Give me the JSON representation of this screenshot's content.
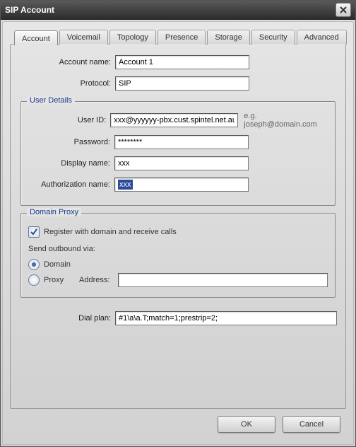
{
  "window": {
    "title": "SIP Account"
  },
  "tabs": [
    {
      "label": "Account",
      "selected": true
    },
    {
      "label": "Voicemail"
    },
    {
      "label": "Topology"
    },
    {
      "label": "Presence"
    },
    {
      "label": "Storage"
    },
    {
      "label": "Security"
    },
    {
      "label": "Advanced"
    }
  ],
  "form": {
    "account_name_label": "Account name:",
    "account_name_value": "Account 1",
    "protocol_label": "Protocol:",
    "protocol_value": "SIP"
  },
  "user_details": {
    "legend": "User Details",
    "user_id_label": "User ID:",
    "user_id_value": "xxx@yyyyyy-pbx.cust.spintel.net.au",
    "user_id_hint": "e.g. joseph@domain.com",
    "password_label": "Password:",
    "password_value": "********",
    "display_name_label": "Display name:",
    "display_name_value": "xxx",
    "auth_name_label": "Authorization name:",
    "auth_name_value": "xxx"
  },
  "domain_proxy": {
    "legend": "Domain Proxy",
    "register_label": "Register with domain and receive calls",
    "register_checked": true,
    "send_outbound_label": "Send outbound via:",
    "radio_domain_label": "Domain",
    "radio_domain_checked": true,
    "radio_proxy_label": "Proxy",
    "radio_proxy_checked": false,
    "address_label": "Address:",
    "address_value": ""
  },
  "dial_plan": {
    "label": "Dial plan:",
    "value": "#1\\a\\a.T;match=1;prestrip=2;"
  },
  "footer": {
    "ok_label": "OK",
    "cancel_label": "Cancel"
  }
}
